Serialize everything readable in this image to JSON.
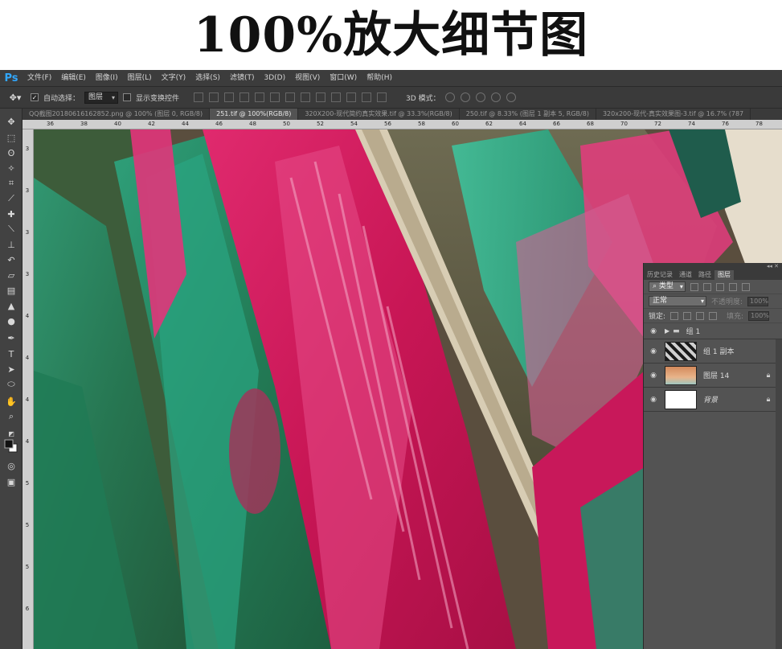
{
  "banner": {
    "title": "100%放大细节图"
  },
  "app": {
    "logo": "Ps",
    "menu": [
      "文件(F)",
      "编辑(E)",
      "图像(I)",
      "图层(L)",
      "文字(Y)",
      "选择(S)",
      "滤镜(T)",
      "3D(D)",
      "视图(V)",
      "窗口(W)",
      "帮助(H)"
    ]
  },
  "options": {
    "auto_select_label": "自动选择：",
    "auto_select_value": "图层",
    "show_transform_label": "显示变换控件",
    "mode_3d_label": "3D 模式："
  },
  "tabs": [
    "QQ截图20180616162852.png @ 100% (图层 0, RGB/8)",
    "251.tif @ 100%(RGB/8)",
    "320X200-现代简约真实效果.tif @ 33.3%(RGB/8)",
    "250.tif @ 8.33% (图层 1 副本 5, RGB/8)",
    "320x200-现代-真实效果图-3.tif @ 16.7% (787"
  ],
  "ruler": {
    "top": [
      "36",
      "38",
      "40",
      "42",
      "44",
      "46",
      "48",
      "50",
      "52",
      "54",
      "56",
      "58",
      "60",
      "62",
      "64",
      "66",
      "68",
      "70",
      "72",
      "74",
      "76",
      "78"
    ],
    "left": [
      "3",
      "3",
      "3",
      "3",
      "4",
      "4",
      "4",
      "4",
      "5",
      "5",
      "5",
      "6"
    ]
  },
  "tools": [
    "move-tool",
    "marquee-tool",
    "lasso-tool",
    "quick-select-tool",
    "crop-tool",
    "eyedropper-tool",
    "healing-brush-tool",
    "brush-tool",
    "clone-stamp-tool",
    "history-brush-tool",
    "eraser-tool",
    "gradient-tool",
    "blur-tool",
    "dodge-tool",
    "pen-tool",
    "type-tool",
    "path-select-tool",
    "shape-tool",
    "hand-tool",
    "zoom-tool"
  ],
  "layers_panel": {
    "tabs": [
      "历史记录",
      "通道",
      "路径",
      "图层"
    ],
    "filter_label": "类型",
    "blend_mode": "正常",
    "opacity_label": "不透明度:",
    "opacity_value": "100%",
    "lock_label": "锁定:",
    "fill_label": "填充:",
    "fill_value": "100%",
    "layers": [
      {
        "name": "组 1"
      },
      {
        "name": "组 1 副本"
      },
      {
        "name": "图层 14"
      },
      {
        "name": "背景"
      }
    ]
  }
}
